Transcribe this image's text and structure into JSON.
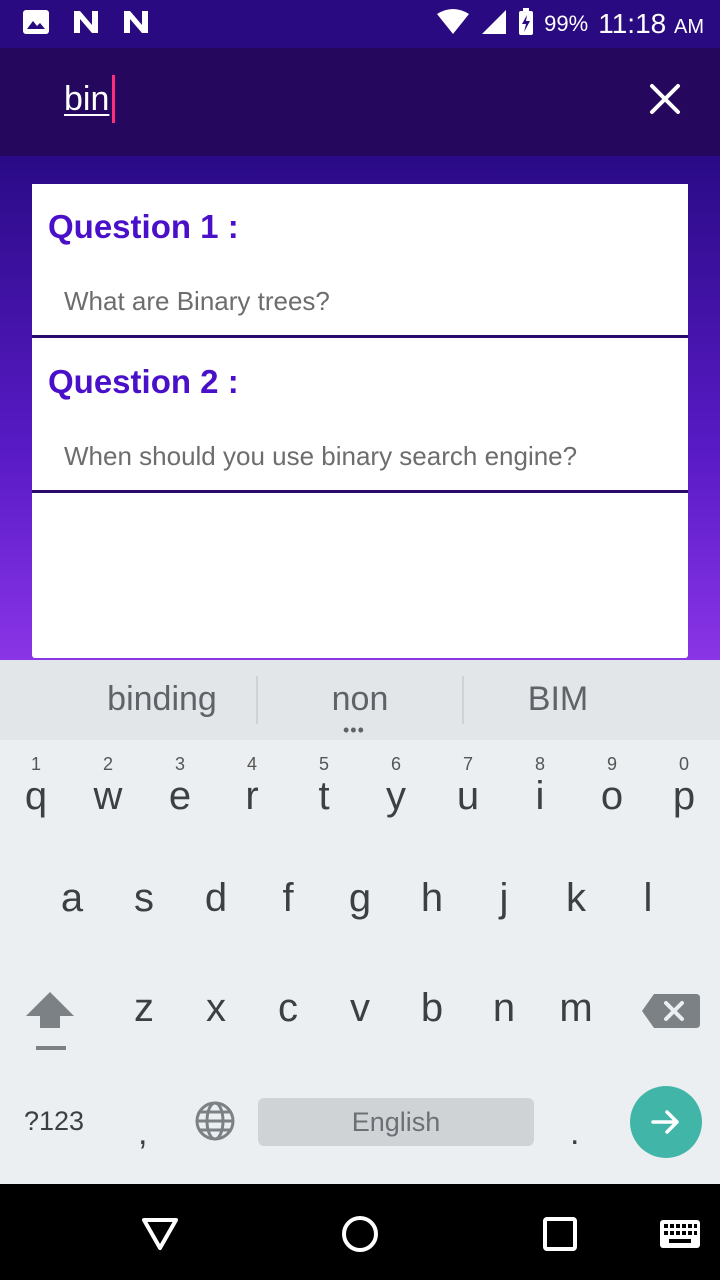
{
  "status_bar": {
    "battery": "99%",
    "time": "11:18",
    "ampm": "AM",
    "icons": [
      "image-icon",
      "n-icon",
      "n-icon",
      "wifi-icon",
      "signal-icon",
      "battery-charging-icon"
    ]
  },
  "search": {
    "query": "bin",
    "close_icon": "close-icon"
  },
  "questions": [
    {
      "title": "Question 1 :",
      "text": "What are Binary trees?"
    },
    {
      "title": "Question 2 :",
      "text": "When should you use binary search engine?"
    }
  ],
  "keyboard": {
    "suggestions": [
      "binding",
      "non",
      "BIM"
    ],
    "row1": [
      {
        "ch": "q",
        "hint": "1"
      },
      {
        "ch": "w",
        "hint": "2"
      },
      {
        "ch": "e",
        "hint": "3"
      },
      {
        "ch": "r",
        "hint": "4"
      },
      {
        "ch": "t",
        "hint": "5"
      },
      {
        "ch": "y",
        "hint": "6"
      },
      {
        "ch": "u",
        "hint": "7"
      },
      {
        "ch": "i",
        "hint": "8"
      },
      {
        "ch": "o",
        "hint": "9"
      },
      {
        "ch": "p",
        "hint": "0"
      }
    ],
    "row2": [
      "a",
      "s",
      "d",
      "f",
      "g",
      "h",
      "j",
      "k",
      "l"
    ],
    "row3": [
      "z",
      "x",
      "c",
      "v",
      "b",
      "n",
      "m"
    ],
    "symbols_label": "?123",
    "comma": ",",
    "space_label": "English",
    "period": ".",
    "icons": {
      "shift": "shift-icon",
      "backspace": "backspace-icon",
      "globe": "globe-icon",
      "enter": "arrow-right-icon"
    }
  },
  "nav": {
    "icons": [
      "back-icon",
      "home-icon",
      "recents-icon",
      "keyboard-icon"
    ]
  },
  "colors": {
    "status_bar": "#2a0a80",
    "app_bar": "#26075e",
    "question_title": "#4a0fc9",
    "cursor": "#ff2e7a",
    "enter_key": "#41b5a8"
  }
}
